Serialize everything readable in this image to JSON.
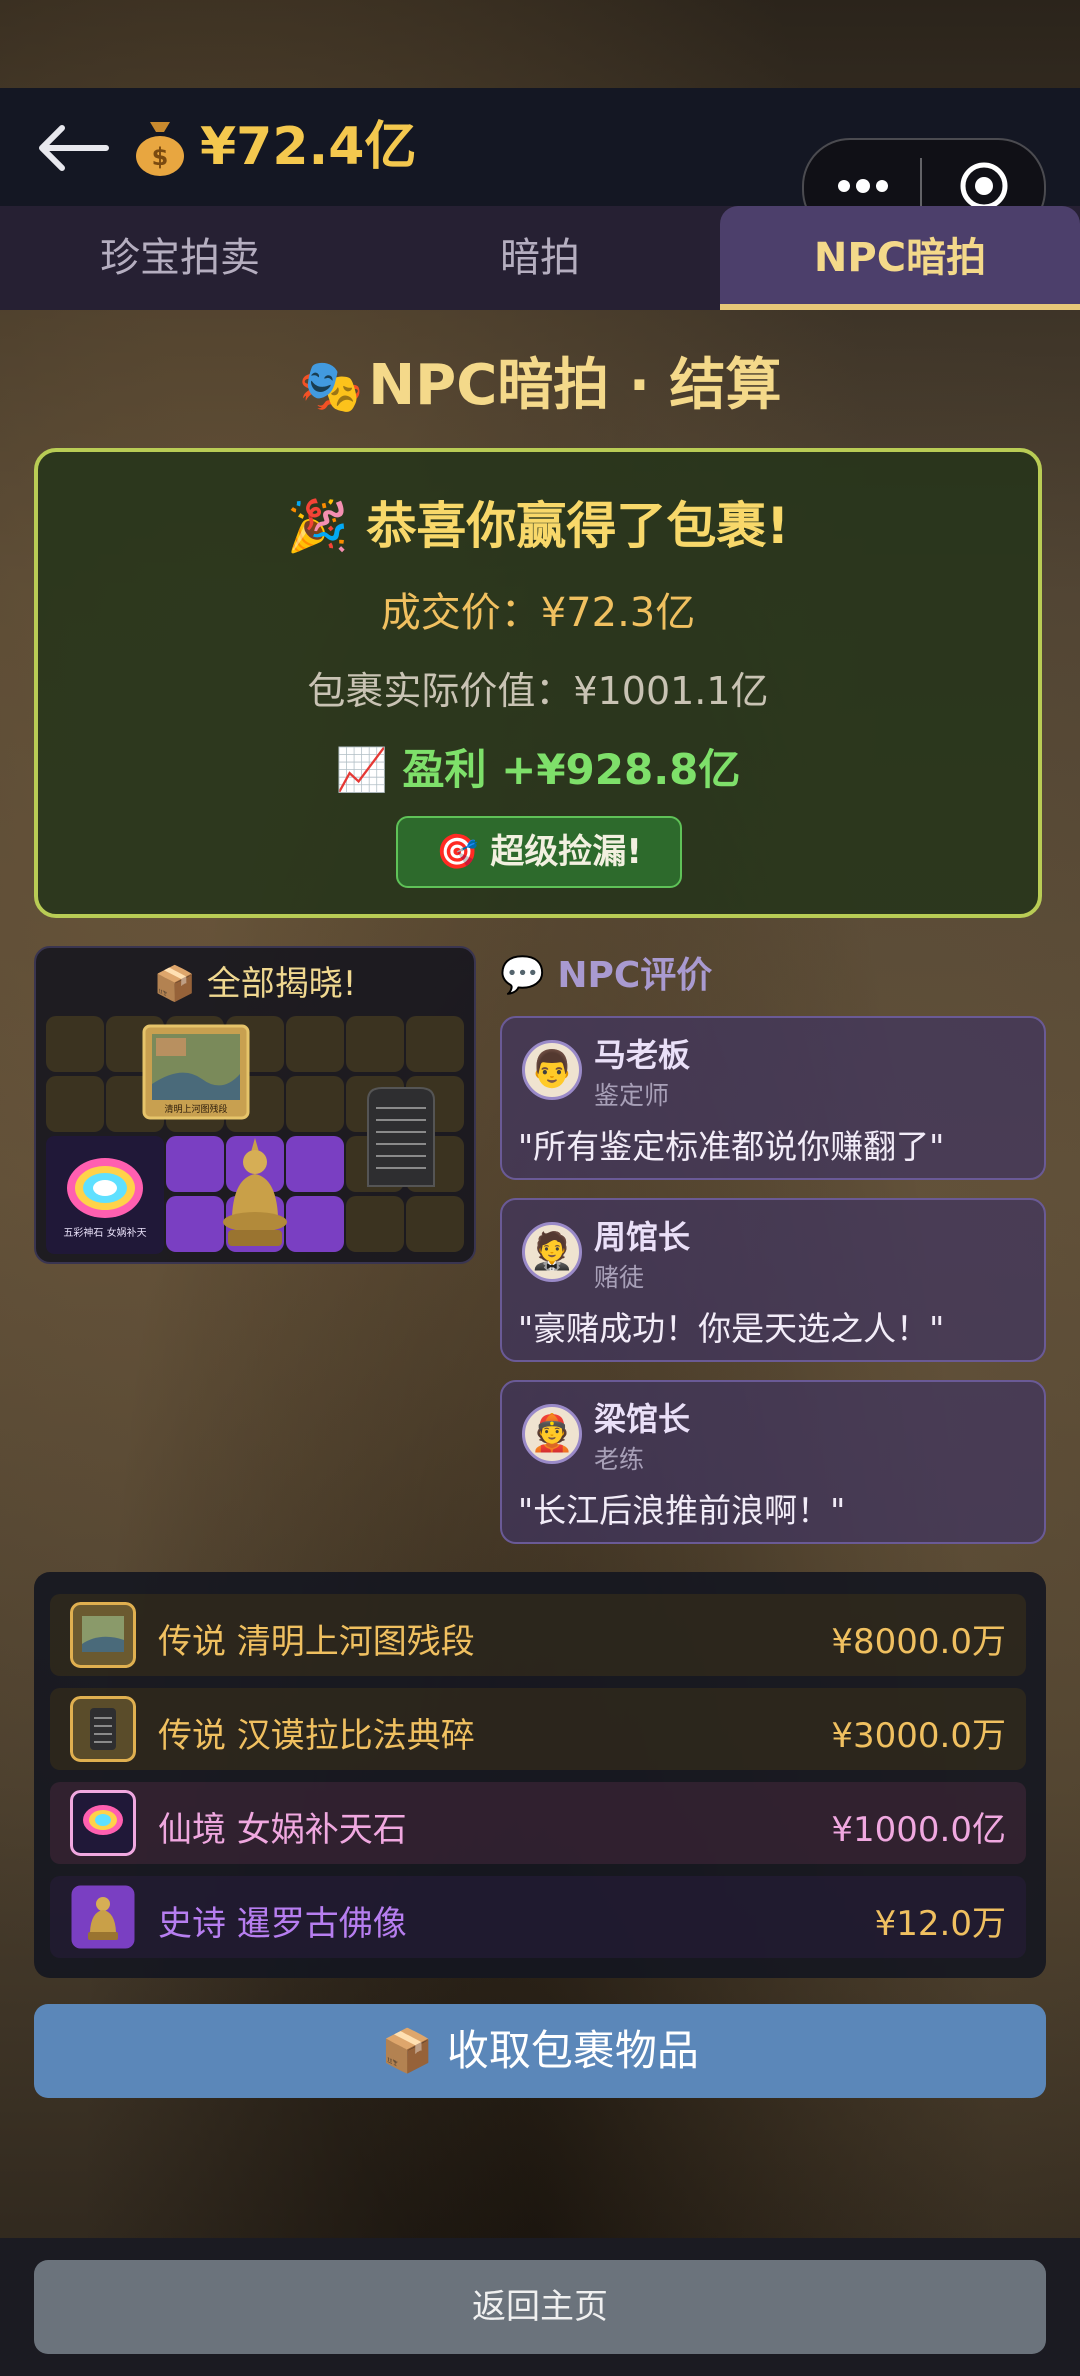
{
  "header": {
    "balance": "¥72.4亿",
    "back_icon": "back-arrow-icon",
    "coin_icon": "money-bag-icon"
  },
  "tabs": [
    {
      "label": "珍宝拍卖",
      "active": false
    },
    {
      "label": "暗拍",
      "active": false
    },
    {
      "label": "NPC暗拍",
      "active": true
    }
  ],
  "page_title": "NPC暗拍 · 结算",
  "result": {
    "congrats": "恭喜你赢得了包裹!",
    "deal_price": "成交价：¥72.3亿",
    "actual_value": "包裹实际价值：¥1001.1亿",
    "profit": "盈利 +¥928.8亿",
    "badge": "超级捡漏!"
  },
  "reveal": {
    "title": "全部揭晓!",
    "item_caption_1": "清明上河图残段",
    "item_caption_2": "五彩神石 女娲补天"
  },
  "npc": {
    "heading": "NPC评价",
    "comments": [
      {
        "name": "马老板",
        "role": "鉴定师",
        "quote": "\"所有鉴定标准都说你赚翻了\""
      },
      {
        "name": "周馆长",
        "role": "赌徒",
        "quote": "\"豪赌成功！你是天选之人！\""
      },
      {
        "name": "梁馆长",
        "role": "老练",
        "quote": "\"长江后浪推前浪啊！\""
      }
    ]
  },
  "items": [
    {
      "name": "传说 清明上河图残段",
      "price": "¥8000.0万",
      "color": "#f0c060"
    },
    {
      "name": "传说 汉谟拉比法典碎",
      "price": "¥3000.0万",
      "color": "#f0c060"
    },
    {
      "name": "仙境 女娲补天石",
      "price": "¥1000.0亿",
      "color": "#f0a8e0"
    },
    {
      "name": "史诗 暹罗古佛像",
      "price": "¥12.0万",
      "color": "#b77ef0"
    }
  ],
  "buttons": {
    "collect": "收取包裹物品",
    "home": "返回主页"
  }
}
